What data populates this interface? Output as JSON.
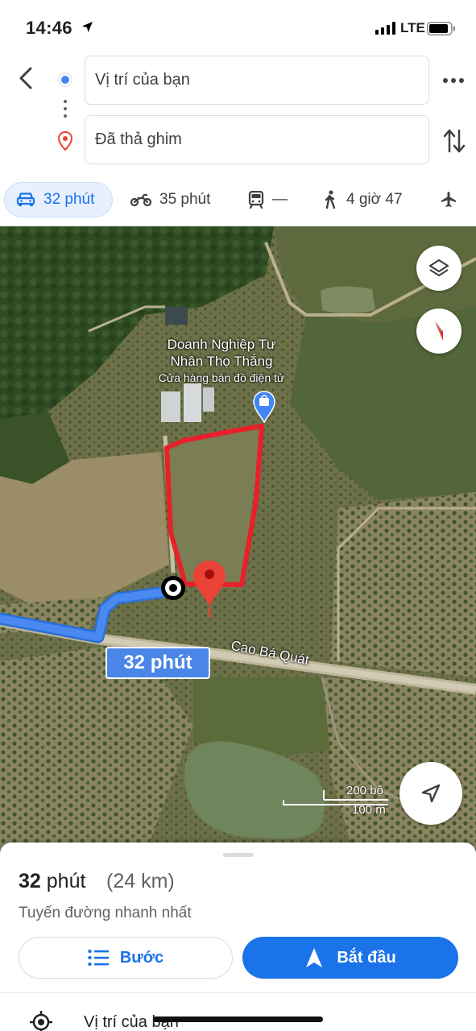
{
  "status_bar": {
    "time": "14:46",
    "network": "LTE"
  },
  "directions": {
    "origin": "Vị trí của bạn",
    "destination": "Đã thả ghim"
  },
  "modes": [
    {
      "name": "car",
      "label": "32 phút",
      "selected": true
    },
    {
      "name": "motorbike",
      "label": "35 phút"
    },
    {
      "name": "transit",
      "label": "—"
    },
    {
      "name": "walk",
      "label": "4 giờ 47"
    },
    {
      "name": "flight",
      "label": ""
    }
  ],
  "map": {
    "poi_name_line1": "Doanh Nghiệp Tư",
    "poi_name_line2": "Nhân Thọ Thắng",
    "poi_category": "Cửa hàng bán đồ điện tử",
    "road_name": "Cao Bá Quát",
    "eta_bubble": "32 phút",
    "scale_imperial": "200 bộ",
    "scale_metric": "100 m"
  },
  "sheet": {
    "duration_value": "32",
    "duration_unit": "phút",
    "distance": "(24 km)",
    "description": "Tuyến đường nhanh nhất",
    "steps_label": "Bước",
    "start_label": "Bắt đầu",
    "location_row": "Vị trí của bạn"
  },
  "colors": {
    "accent": "#1a73e8",
    "route": "#4a86e8",
    "boundary": "#e8202a",
    "pin": "#ea4335"
  }
}
